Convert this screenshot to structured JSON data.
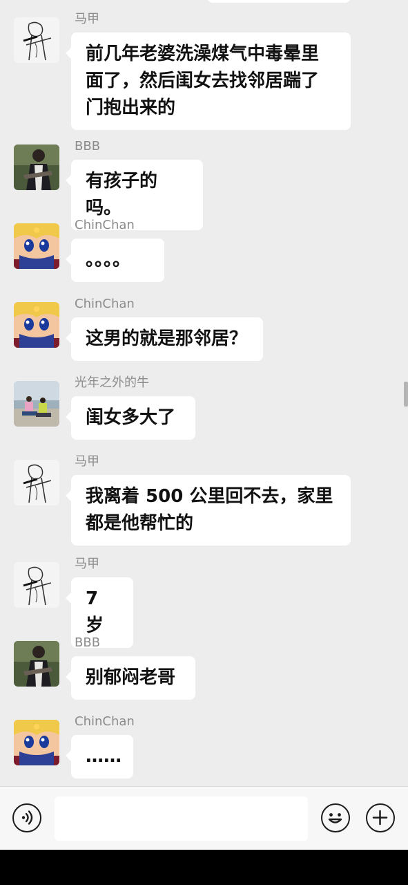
{
  "chat": {
    "messages": [
      {
        "sender": "马甲",
        "text": "前几年老婆洗澡煤气中毒晕里面了，然后闺女去找邻居踹了门抱出来的",
        "avatar": "sketch-person-avatar"
      },
      {
        "sender": "BBB",
        "text": "有孩子的吗。",
        "avatar": "photo-person-avatar"
      },
      {
        "sender": "ChinChan",
        "text": "。。。。",
        "avatar": "anime-girl-avatar"
      },
      {
        "sender": "ChinChan",
        "text": "这男的就是那邻居？",
        "avatar": "anime-girl-avatar"
      },
      {
        "sender": "光年之外的牛",
        "text": "闺女多大了",
        "avatar": "beach-photo-avatar"
      },
      {
        "sender": "马甲",
        "text": "我离着 500 公里回不去，家里都是他帮忙的",
        "avatar": "sketch-person-avatar"
      },
      {
        "sender": "马甲",
        "text": "7 岁",
        "avatar": "sketch-person-avatar"
      },
      {
        "sender": "BBB",
        "text": "别郁闷老哥",
        "avatar": "photo-person-avatar"
      },
      {
        "sender": "ChinChan",
        "text": "……",
        "avatar": "anime-girl-avatar"
      }
    ]
  },
  "input_bar": {
    "value": "",
    "icons": [
      "voice-icon",
      "emoji-icon",
      "plus-icon"
    ]
  },
  "colors": {
    "chat_background": "#ededed",
    "bubble": "#ffffff",
    "sender_name": "#8c8c8c",
    "nav_bar": "#000000"
  }
}
